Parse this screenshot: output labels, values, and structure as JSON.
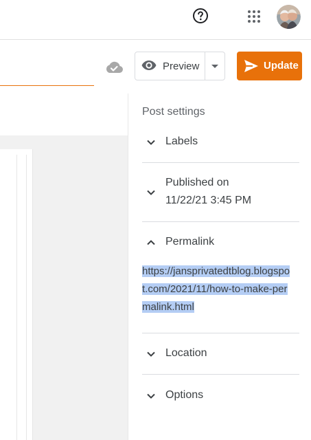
{
  "header": {
    "icons": [
      "help-icon",
      "apps-icon",
      "avatar"
    ]
  },
  "toolbar": {
    "preview_label": "Preview",
    "update_label": "Update",
    "accent_color": "#e8710a"
  },
  "settings": {
    "title": "Post settings",
    "labels_label": "Labels",
    "published_label": "Published on",
    "published_value": "11/22/21 3:45 PM",
    "permalink_label": "Permalink",
    "permalink_url": "https://jansprivatedtblog.blogspot.com/2021/11/how-to-make-permalink.html",
    "location_label": "Location",
    "options_label": "Options"
  }
}
